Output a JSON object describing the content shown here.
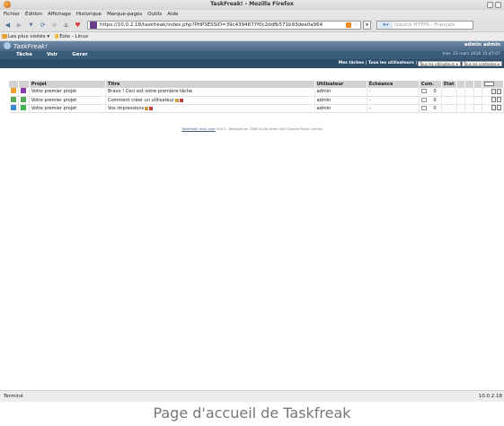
{
  "window": {
    "title": "TaskFreak! - Mozilla Firefox"
  },
  "menubar": [
    "Fichier",
    "Édition",
    "Affichage",
    "Historique",
    "Marque-pages",
    "Outils",
    "Aide"
  ],
  "navbar": {
    "url": "https://10.0.2.18/taskfreak/index.php?PHPSESSID=39c4394677f0c2ddfb571b93dee0a964",
    "search_placeholder": "Ixquick HTTPS - Français"
  },
  "bookmarks": [
    "Les plus visités",
    "Eole - Linux"
  ],
  "app": {
    "logo": "TaskFreak!",
    "user": "admin admin",
    "date": "mer. 23 mars 2016 15:47:07",
    "menu": [
      "Tâche",
      "Voir",
      "Gérer"
    ],
    "filter_links": "Mes tâches | Tous les utilisateurs |",
    "filter_select_1": "Tous les utilisateurs",
    "filter_select_2": "Tous les contextes"
  },
  "table": {
    "headers": [
      "Projet",
      "Titre",
      "Utilisateur",
      "Échéance",
      "Com.",
      "Etat"
    ],
    "rows": [
      {
        "project": "Votre premier projet",
        "title": "Bravo ! Ceci est votre première tâche",
        "user": "admin",
        "due": "-",
        "comments": "0",
        "prio_color": "#f0a030",
        "ctx_color": "#8a3aa8"
      },
      {
        "project": "Votre premier projet",
        "title": "Comment créer un utilisateur",
        "user": "admin",
        "due": "-",
        "comments": "0",
        "prio_color": "#58a858",
        "ctx_color": "#58a858"
      },
      {
        "project": "Votre premier projet",
        "title": "Vos impressions",
        "user": "admin",
        "due": "-",
        "comments": "0",
        "prio_color": "#3a8ad0",
        "ctx_color": "#40b050"
      }
    ]
  },
  "footer": {
    "link": "TaskFreak! multi user",
    "text": "v0.6.2 - Released on 2008-04-06 under GNU General Public License"
  },
  "statusbar": {
    "left": "Terminé",
    "right": "10.0.2.18"
  },
  "caption": "Page d'accueil de Taskfreak"
}
